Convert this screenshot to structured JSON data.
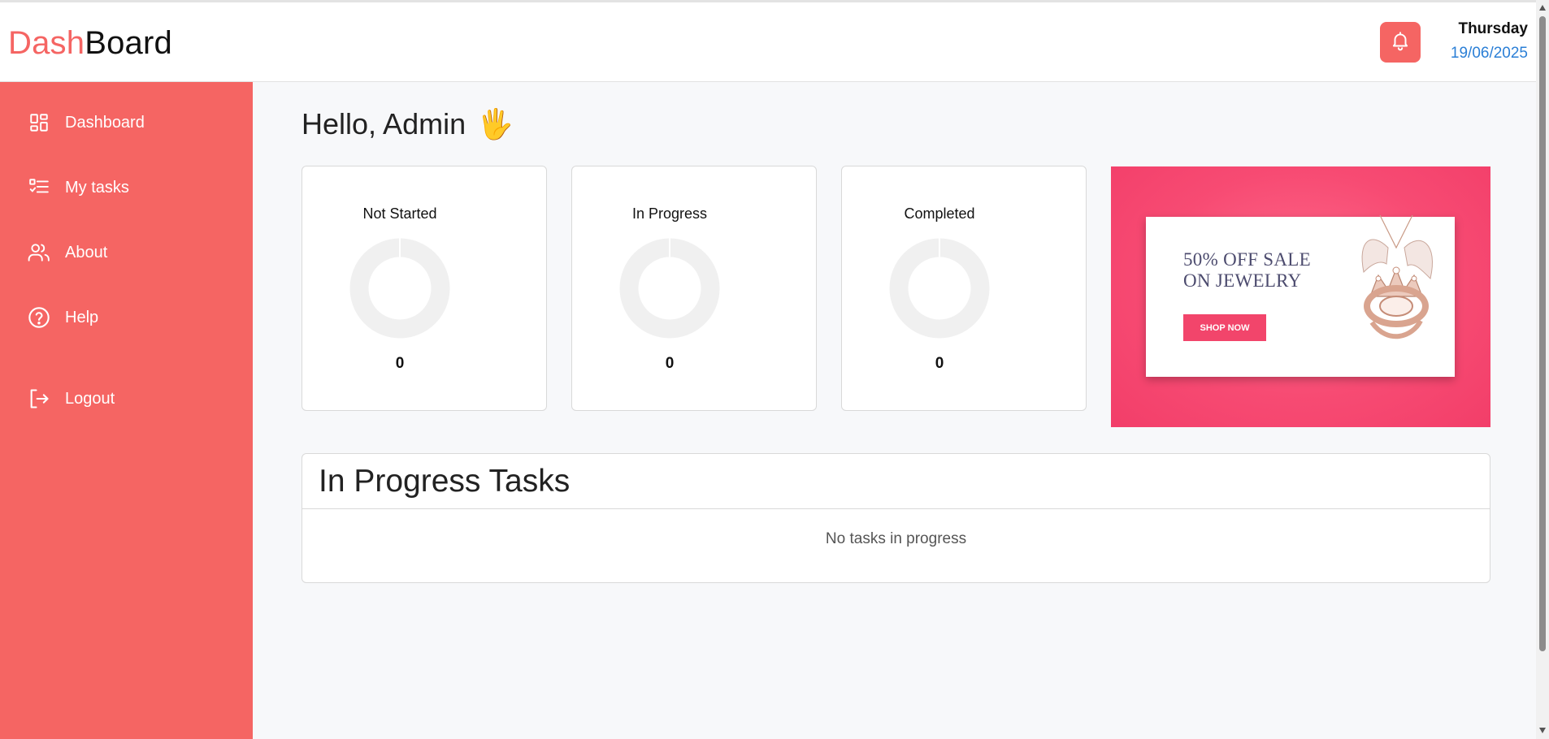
{
  "header": {
    "logo_part1": "Dash",
    "logo_part2": "Board",
    "day": "Thursday",
    "date": "19/06/2025",
    "bell_icon": "bell-icon"
  },
  "sidebar": {
    "items": [
      {
        "label": "Dashboard",
        "icon": "grid-icon"
      },
      {
        "label": "My tasks",
        "icon": "task-list-icon"
      },
      {
        "label": "About",
        "icon": "users-icon"
      },
      {
        "label": "Help",
        "icon": "help-circle-icon"
      },
      {
        "label": "Logout",
        "icon": "logout-icon"
      }
    ]
  },
  "main": {
    "greeting": "Hello, Admin",
    "greeting_emoji": "🖐",
    "stats": [
      {
        "title": "Not Started",
        "value": "0"
      },
      {
        "title": "In Progress",
        "value": "0"
      },
      {
        "title": "Completed",
        "value": "0"
      }
    ],
    "ad": {
      "line1": "50% OFF SALE",
      "line2": "ON JEWELRY",
      "button": "SHOP NOW"
    },
    "tasks_panel": {
      "title": "In Progress Tasks",
      "empty_text": "No tasks in progress"
    }
  },
  "colors": {
    "accent": "#f56563",
    "date_blue": "#2b7fd6",
    "ad_pink": "#f74b73"
  }
}
